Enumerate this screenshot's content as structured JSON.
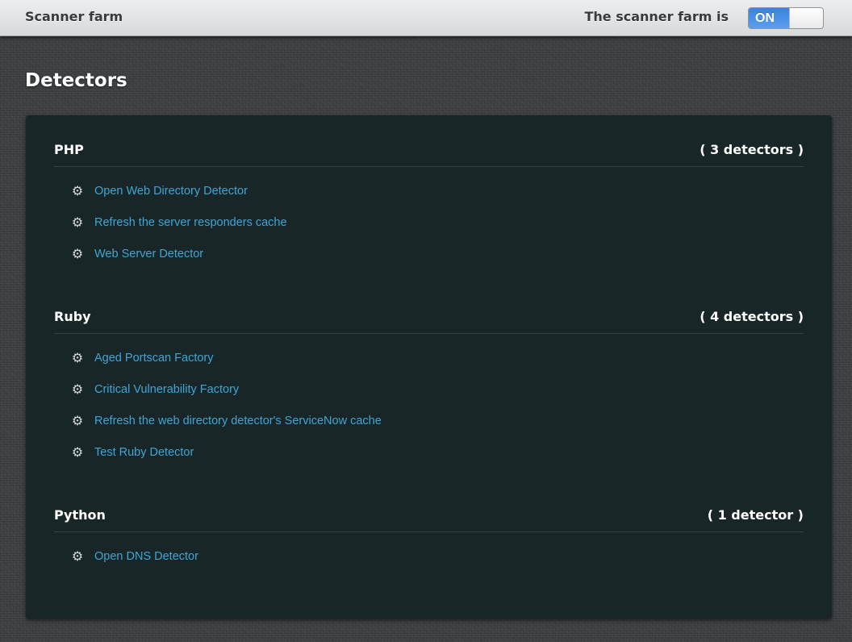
{
  "topbar": {
    "brand": "Scanner farm",
    "status_label": "The scanner farm is",
    "toggle_state": "ON"
  },
  "page_title": "Detectors",
  "icons": {
    "detector_icon": "gear-icon"
  },
  "colors": {
    "link": "#3ea6d6",
    "toggle_on": "#3a82e0",
    "panel": "#182627"
  },
  "groups": [
    {
      "name": "PHP",
      "count": "( 3 detectors )",
      "detectors": [
        "Open Web Directory Detector",
        "Refresh the server responders cache",
        "Web Server Detector"
      ]
    },
    {
      "name": "Ruby",
      "count": "( 4 detectors )",
      "detectors": [
        "Aged Portscan Factory",
        "Critical Vulnerability Factory",
        "Refresh the web directory detector's ServiceNow cache",
        "Test Ruby Detector"
      ]
    },
    {
      "name": "Python",
      "count": "( 1 detector )",
      "detectors": [
        "Open DNS Detector"
      ]
    }
  ]
}
